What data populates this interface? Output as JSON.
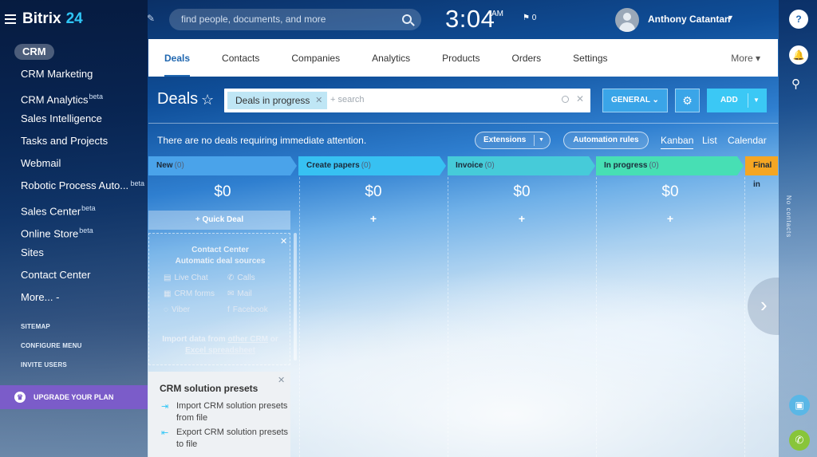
{
  "app": {
    "logo_main": "Bitrix",
    "logo_num": "24"
  },
  "header": {
    "search_placeholder": "find people, documents, and more",
    "clock": "3:04",
    "ampm": "AM",
    "flag_count": "0",
    "user_name": "Anthony Catantan"
  },
  "sidebar": {
    "section": "CRM",
    "items": [
      {
        "label": "CRM Marketing",
        "sup": ""
      },
      {
        "label": "CRM Analytics",
        "sup": "beta"
      },
      {
        "label": "Sales Intelligence",
        "sup": ""
      },
      {
        "label": "Tasks and Projects",
        "sup": ""
      },
      {
        "label": "Webmail",
        "sup": ""
      },
      {
        "label": "Robotic Process Auto...",
        "sup": "beta"
      },
      {
        "label": "Sales Center",
        "sup": "beta"
      },
      {
        "label": "Online Store",
        "sup": "beta"
      },
      {
        "label": "Sites",
        "sup": ""
      },
      {
        "label": "Contact Center",
        "sup": ""
      },
      {
        "label": "More...",
        "sup": ""
      }
    ],
    "small_links": [
      "SITEMAP",
      "CONFIGURE MENU",
      "INVITE USERS"
    ],
    "upgrade": "UPGRADE YOUR PLAN"
  },
  "tabs": {
    "items": [
      "Deals",
      "Contacts",
      "Companies",
      "Analytics",
      "Products",
      "Orders",
      "Settings"
    ],
    "more": "More"
  },
  "toolbar": {
    "title": "Deals",
    "filter_chip": "Deals in progress",
    "filter_placeholder": "+ search",
    "general": "GENERAL",
    "add": "ADD"
  },
  "notice": "There are no deals requiring immediate attention.",
  "actions": {
    "extensions": "Extensions",
    "automation": "Automation rules"
  },
  "views": [
    "Kanban",
    "List",
    "Calendar"
  ],
  "stages": [
    {
      "name": "New",
      "count": "(0)",
      "sum": "$0",
      "color": "#4aa3ea"
    },
    {
      "name": "Create papers",
      "count": "(0)",
      "sum": "$0",
      "color": "#37c1f2"
    },
    {
      "name": "Invoice",
      "count": "(0)",
      "sum": "$0",
      "color": "#46cbd9"
    },
    {
      "name": "In progress",
      "count": "(0)",
      "sum": "$0",
      "color": "#47dfb4"
    },
    {
      "name": "Final in",
      "count": "",
      "sum": "",
      "color": "#f5a623"
    }
  ],
  "quick_deal": "+ Quick Deal",
  "contact_center": {
    "title": "Contact Center",
    "subtitle": "Automatic deal sources",
    "channels": [
      "Live Chat",
      "Calls",
      "CRM forms",
      "Mail",
      "Viber",
      "Facebook"
    ],
    "import_prefix": "Import data from",
    "import_link1": "other CRM",
    "import_or": "or",
    "import_link2": "Excel spreadsheet"
  },
  "presets": {
    "title": "CRM solution presets",
    "items": [
      "Import CRM solution presets from file",
      "Export CRM solution presets to file"
    ]
  },
  "rightbar": {
    "no_contacts": "No contacts"
  },
  "colors": {
    "accent": "#2067b0",
    "add": "#3bc8f5",
    "upgrade": "#7b5cc9"
  }
}
